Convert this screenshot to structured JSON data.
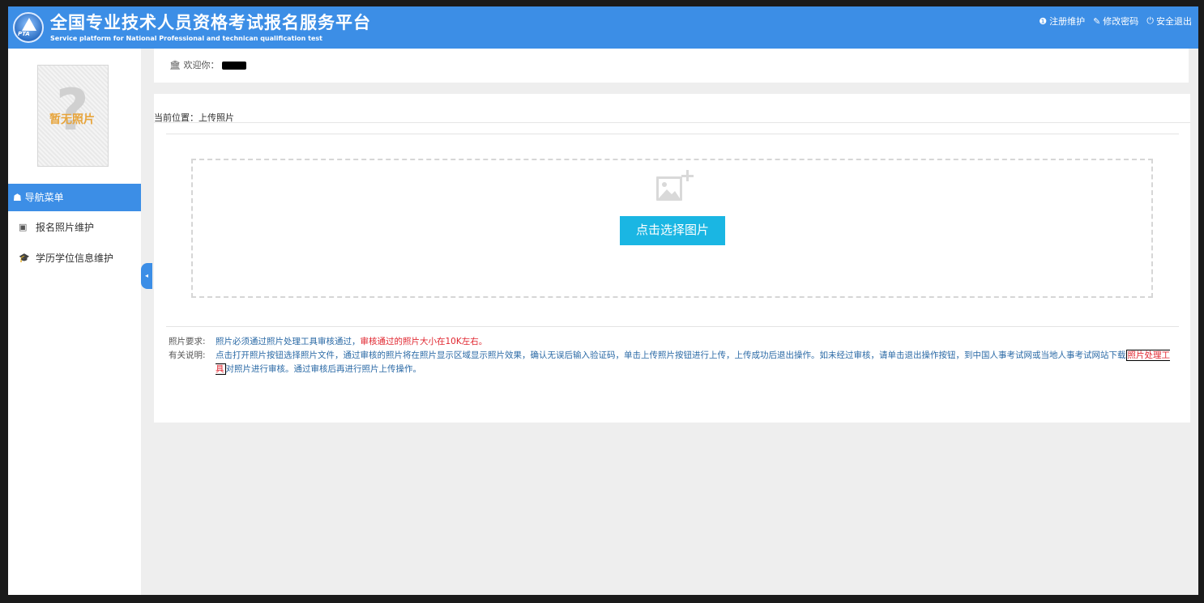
{
  "header": {
    "title": "全国专业技术人员资格考试报名服务平台",
    "subtitle": "Service platform for National Professional and technican qualification test",
    "logo_text": "PTA",
    "links": [
      {
        "icon": "info-circle-icon",
        "glyph": "❶",
        "label": "注册维护"
      },
      {
        "icon": "edit-icon",
        "glyph": "✎",
        "label": "修改密码"
      },
      {
        "icon": "power-icon",
        "glyph": "⏻",
        "label": "安全退出"
      }
    ]
  },
  "sidebar": {
    "avatar_text": "暂无照片",
    "avatar_glyph": "?",
    "nav_header": "导航菜单",
    "nav_header_glyph": "☗",
    "items": [
      {
        "label": "报名照片维护",
        "icon": "picture-icon",
        "glyph": "▣"
      },
      {
        "label": "学历学位信息维护",
        "icon": "graduation-cap-icon",
        "glyph": "🎓"
      }
    ]
  },
  "welcome": {
    "glyph": "🏛",
    "text": "欢迎你："
  },
  "main": {
    "breadcrumb": "当前位置：上传照片",
    "choose_button": "点击选择图片",
    "notes": {
      "req_label": "照片要求:",
      "req_text": "照片必须通过照片处理工具审核通过，",
      "req_red": "审核通过的照片大小在10K左右。",
      "desc_label": "有关说明:",
      "desc_text1": "点击打开照片按钮选择照片文件，通过审核的照片将在照片显示区域显示照片效果，确认无误后输入验证码，单击上传照片按钮进行上传，上传成功后退出操作。如未经过审核，请单击退出操作按钮，到中国人事考试网或当地人事考试网站下载",
      "desc_link": "照片处理工具",
      "desc_text2": "对照片进行审核。通过审核后再进行照片上传操作。"
    }
  },
  "colors": {
    "header_bg": "#3c8ee6",
    "button_bg": "#1ab6e3",
    "warning_red": "#e0262f"
  }
}
